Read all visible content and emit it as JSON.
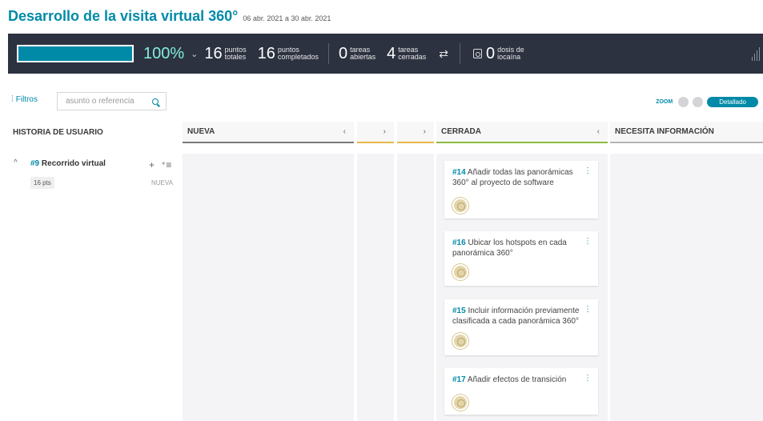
{
  "header": {
    "title": "Desarrollo de la visita virtual 360°",
    "dates": "06 abr. 2021 a 30 abr. 2021"
  },
  "summary": {
    "progress_fraction": 1.0,
    "progress_pct": "100%",
    "chevron": "⌄",
    "points_total": "16",
    "points_total_label_1": "puntos",
    "points_total_label_2": "totales",
    "points_completed": "16",
    "points_completed_label_1": "puntos",
    "points_completed_label_2": "completados",
    "tasks_open": "0",
    "tasks_open_label_1": "tareas",
    "tasks_open_label_2": "abiertas",
    "tasks_closed": "4",
    "tasks_closed_label_1": "tareas",
    "tasks_closed_label_2": "cerradas",
    "swap_glyph": "⇄",
    "iocaine": "0",
    "iocaine_label_1": "dosis de",
    "iocaine_label_2": "iocaína"
  },
  "toolbar": {
    "filters_label": "Filtros",
    "filter_glyph": "⫶",
    "search_placeholder": "asunto o referencia",
    "zoom_label": "ZOOM",
    "zoom_selected": "Detallado"
  },
  "columns": [
    {
      "label": "HISTORIA DE USUARIO",
      "arrow": ""
    },
    {
      "label": "NUEVA",
      "arrow": "‹"
    },
    {
      "label": "",
      "arrow": "›"
    },
    {
      "label": "",
      "arrow": "›"
    },
    {
      "label": "CERRADA",
      "arrow": "‹"
    },
    {
      "label": "NECESITA INFORMACIÓN",
      "arrow": ""
    }
  ],
  "colors": {
    "accent": "#008aa8",
    "nueva_line": "#7a7a7a",
    "progress_lines": "#e8b84a",
    "cerrada_line": "#8dbb3c",
    "info_line": "#b5b5b5"
  },
  "story": {
    "caret": "^",
    "ref": "#9",
    "title": "Recorrido virtual",
    "add_glyph": "+",
    "add_task_glyph": "⁺≡",
    "points": "16 pts",
    "status": "NUEVA"
  },
  "cards": [
    {
      "ref": "#14",
      "text": "Añadir todas las panorámicas 360° al proyecto de software"
    },
    {
      "ref": "#16",
      "text": "Ubicar los hotspots en cada panorámica 360°"
    },
    {
      "ref": "#15",
      "text": "Incluir información previamente clasificada a cada panorámica 360°"
    },
    {
      "ref": "#17",
      "text": "Añadir efectos de transición"
    }
  ],
  "card_menu_glyph": "⋮"
}
